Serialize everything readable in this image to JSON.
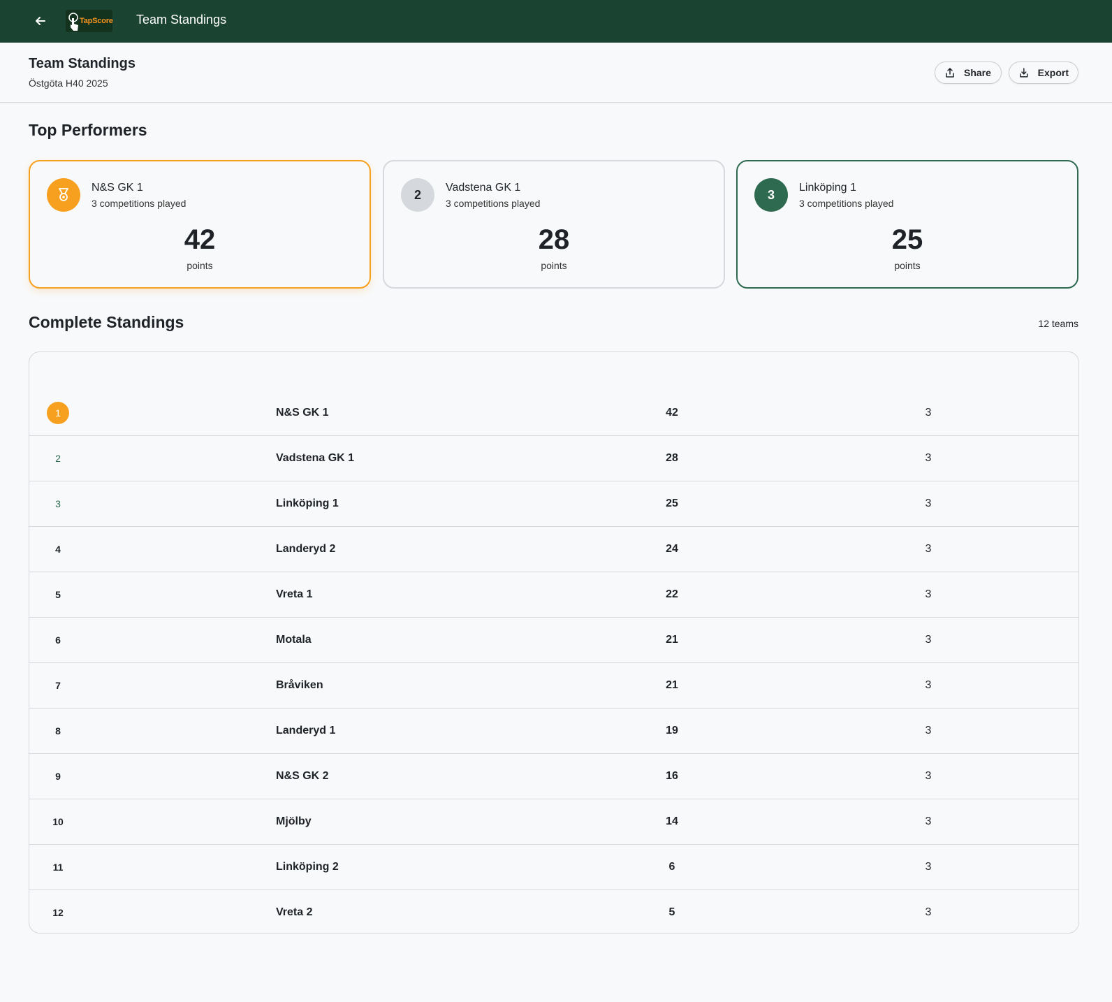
{
  "topbar": {
    "title": "Team Standings",
    "logo_text": "TapScore",
    "back_icon": "arrow-left-icon",
    "background": "#1b4332"
  },
  "header": {
    "title": "Team Standings",
    "subtitle": "Östgöta H40 2025",
    "share_label": "Share",
    "export_label": "Export"
  },
  "top_performers": {
    "title": "Top Performers",
    "cards": [
      {
        "badge": "medal-icon",
        "name": "N&S GK 1",
        "played": "3 competitions played",
        "points": "42",
        "points_label": "points",
        "accent": "#f7a01f"
      },
      {
        "badge": "2",
        "name": "Vadstena GK 1",
        "played": "3 competitions played",
        "points": "28",
        "points_label": "points",
        "accent": "#d5d8dc"
      },
      {
        "badge": "3",
        "name": "Linköping 1",
        "played": "3 competitions played",
        "points": "25",
        "points_label": "points",
        "accent": "#2d6a4f"
      }
    ]
  },
  "standings": {
    "title": "Complete Standings",
    "count": "12 teams",
    "rows": [
      {
        "rank": "1",
        "team": "N&S GK 1",
        "points": "42",
        "played": "3"
      },
      {
        "rank": "2",
        "team": "Vadstena GK 1",
        "points": "28",
        "played": "3"
      },
      {
        "rank": "3",
        "team": "Linköping 1",
        "points": "25",
        "played": "3"
      },
      {
        "rank": "4",
        "team": "Landeryd 2",
        "points": "24",
        "played": "3"
      },
      {
        "rank": "5",
        "team": "Vreta 1",
        "points": "22",
        "played": "3"
      },
      {
        "rank": "6",
        "team": "Motala",
        "points": "21",
        "played": "3"
      },
      {
        "rank": "7",
        "team": "Bråviken",
        "points": "21",
        "played": "3"
      },
      {
        "rank": "8",
        "team": "Landeryd 1",
        "points": "19",
        "played": "3"
      },
      {
        "rank": "9",
        "team": "N&S GK 2",
        "points": "16",
        "played": "3"
      },
      {
        "rank": "10",
        "team": "Mjölby",
        "points": "14",
        "played": "3"
      },
      {
        "rank": "11",
        "team": "Linköping 2",
        "points": "6",
        "played": "3"
      },
      {
        "rank": "12",
        "team": "Vreta 2",
        "points": "5",
        "played": "3"
      }
    ]
  }
}
